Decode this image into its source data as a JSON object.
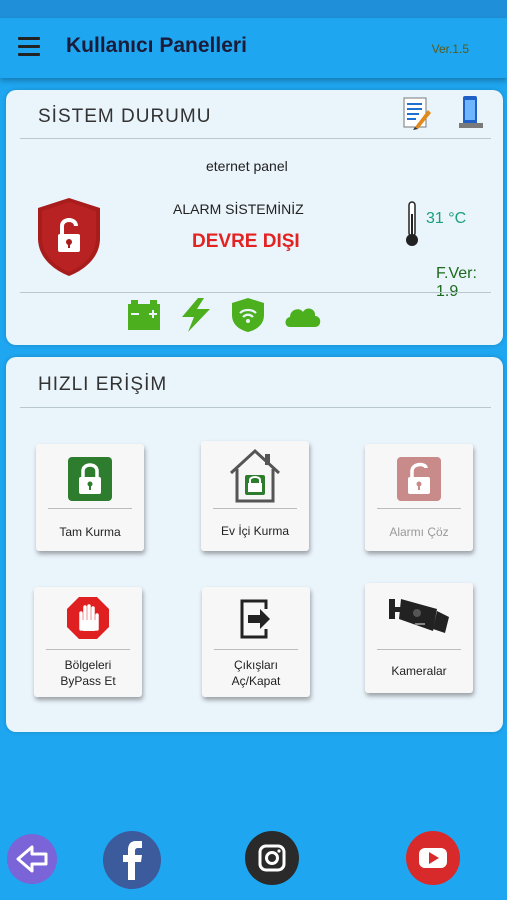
{
  "header": {
    "title": "Kullanıcı Panelleri",
    "version": "Ver.1.5"
  },
  "system_status": {
    "title": "SİSTEM DURUMU",
    "panel_name": "eternet panel",
    "alarm_label": "ALARM SİSTEMİNİZ",
    "alarm_status": "DEVRE DIŞI",
    "temperature": "31 °C",
    "firmware": "F.Ver: 1.9",
    "icons": [
      "battery-icon",
      "power-icon",
      "wifi-shield-icon",
      "cloud-icon"
    ]
  },
  "quick_access": {
    "title": "HIZLI ERİŞİM",
    "tiles": [
      {
        "label": "Tam Kurma",
        "icon": "lock-icon",
        "enabled": true
      },
      {
        "label": "Ev İçi Kurma",
        "icon": "home-lock-icon",
        "enabled": true
      },
      {
        "label": "Alarmı Çöz",
        "icon": "unlock-icon",
        "enabled": false
      },
      {
        "label": "Bölgeleri ByPass Et",
        "line1": "Bölgeleri",
        "line2": "ByPass Et",
        "icon": "stop-hand-icon",
        "enabled": true
      },
      {
        "label": "Çıkışları Aç/Kapat",
        "line1": "Çıkışları",
        "line2": "Aç/Kapat",
        "icon": "exit-icon",
        "enabled": true
      },
      {
        "label": "Kameralar",
        "icon": "camera-icon",
        "enabled": true
      }
    ]
  },
  "bottom_nav": [
    "back-icon",
    "facebook-icon",
    "instagram-icon",
    "youtube-icon"
  ],
  "colors": {
    "primary": "#1ea6f0",
    "alarm_off": "#e32222",
    "armed_green": "#2e7d2e",
    "shield_red": "#a81c1c",
    "status_green": "#4caf1e"
  }
}
